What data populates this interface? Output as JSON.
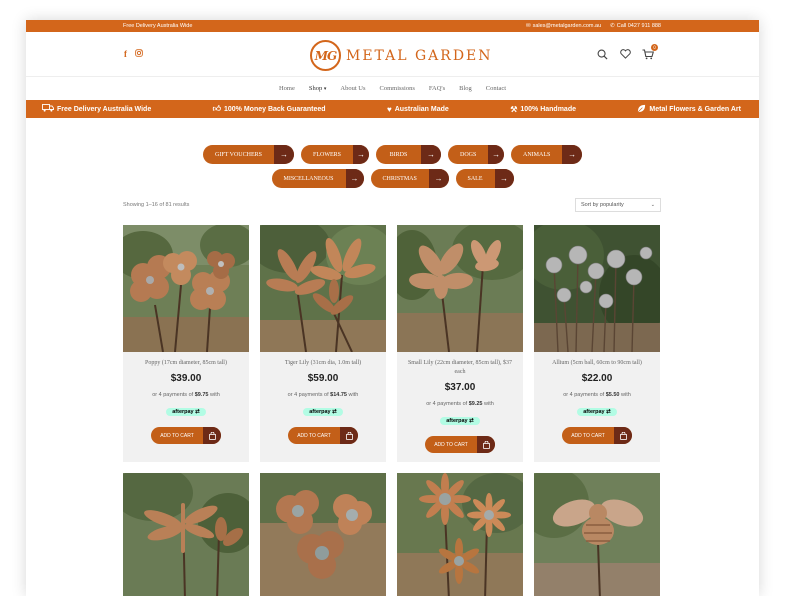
{
  "topbar": {
    "delivery": "Free Delivery Australia Wide",
    "email": "sales@metalgarden.com.au",
    "phone": "Call 0427 911 888"
  },
  "header": {
    "logo_mark": "MG",
    "logo_text": "METAL GARDEN"
  },
  "nav": {
    "items": [
      "Home",
      "Shop",
      "About Us",
      "Commissions",
      "FAQ's",
      "Blog",
      "Contact"
    ]
  },
  "cart": {
    "count": "0"
  },
  "benefits": [
    {
      "label": "Free Delivery Australia Wide",
      "icon": "truck-icon"
    },
    {
      "label": "100% Money Back Guaranteed",
      "icon": "thumbs-up-icon"
    },
    {
      "label": "Australian Made",
      "icon": "heart-icon"
    },
    {
      "label": "100% Handmade",
      "icon": "hammer-icon"
    },
    {
      "label": "Metal Flowers & Garden Art",
      "icon": "leaf-icon"
    }
  ],
  "categories": {
    "row1": [
      "GIFT VOUCHERS",
      "FLOWERS",
      "BIRDS",
      "DOGS",
      "ANIMALS"
    ],
    "row2": [
      "MISCELLANEOUS",
      "CHRISTMAS",
      "SALE"
    ]
  },
  "results_text": "Showing 1–16 of 81 results",
  "sort": {
    "selected": "Sort by popularity"
  },
  "afterpay_label": "afterpay",
  "add_to_cart_label": "ADD TO CART",
  "products": [
    {
      "name": "Poppy (17cm diameter, 85cm tall)",
      "price": "$39.00",
      "installment": "$9.75"
    },
    {
      "name": "Tiger Lily (31cm dia, 1.0m tall)",
      "price": "$59.00",
      "installment": "$14.75"
    },
    {
      "name": "Small Lily (22cm diameter, 85cm tall), $37 each",
      "price": "$37.00",
      "installment": "$9.25"
    },
    {
      "name": "Allium (5cm ball, 60cm to 90cm tall)",
      "price": "$22.00",
      "installment": "$5.50"
    }
  ],
  "colors": {
    "brand_orange": "#d3661b",
    "button_orange": "#c35f18",
    "dark_brown": "#6d2a17",
    "afterpay_mint": "#b2fce4"
  }
}
